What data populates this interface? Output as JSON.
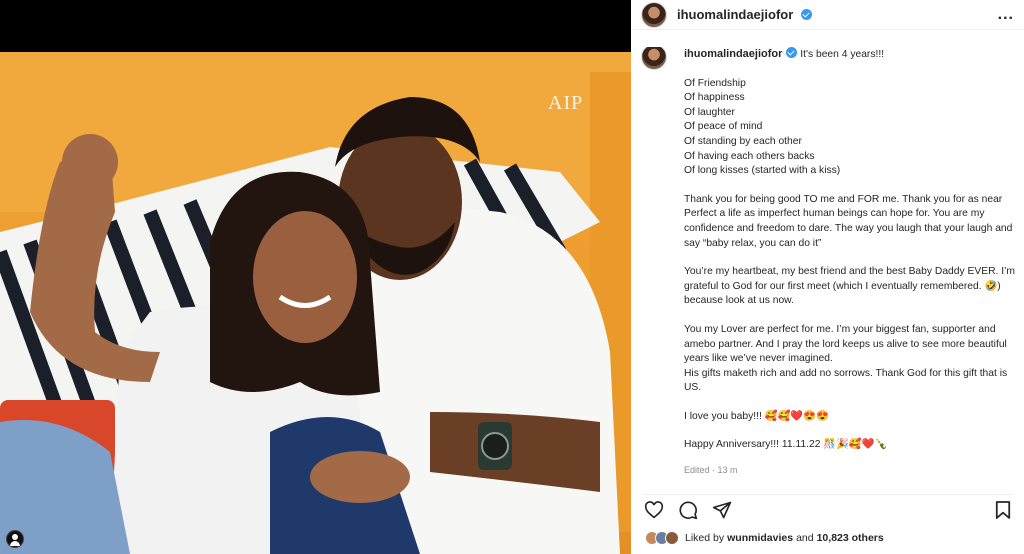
{
  "header": {
    "username": "ihuomalindaejiofor",
    "more_label": "..."
  },
  "media": {
    "watermark": "AIP"
  },
  "caption": {
    "username": "ihuomalindaejiofor",
    "lead": "It's been 4 years!!!",
    "list": [
      "Of Friendship",
      "Of happiness",
      "Of laughter",
      "Of peace of mind",
      "Of standing by each other",
      "Of having each others backs",
      "Of long kisses (started with a kiss)"
    ],
    "p1": "Thank you for being good TO me and FOR me. Thank you for as near Perfect a life as imperfect human beings can hope for. You are my confidence and freedom to dare. The way you laugh that your laugh and say “baby relax, you can do it”",
    "p2": "You’re my heartbeat, my best friend and the best Baby Daddy EVER. I’m grateful to God for our first meet (which I eventually remembered. 🤣) because look at us now.",
    "p3": "You my Lover are perfect for me. I’m your biggest fan, supporter and amebo partner. And I pray the lord keeps us alive to see more beautiful years like we’ve never imagined.",
    "p3b": "His gifts maketh rich and add no sorrows. Thank God for this gift that is US.",
    "p4": "I love you baby!!! 🥰🥰❤️😍😍",
    "p5": "Happy Anniversary!!! 11.11.22 🎊🎉🥰❤️🍾",
    "edited": "Edited · 13 m"
  },
  "likes": {
    "prefix": "Liked by",
    "user": "wunmidavies",
    "and": "and",
    "count": "10,823 others"
  },
  "icons": [
    "heart-icon",
    "comment-icon",
    "share-icon",
    "bookmark-icon",
    "verified-badge-icon",
    "user-tag-icon"
  ],
  "colors": {
    "verified": "#3897f0",
    "sofa": "#ee9b2c"
  }
}
